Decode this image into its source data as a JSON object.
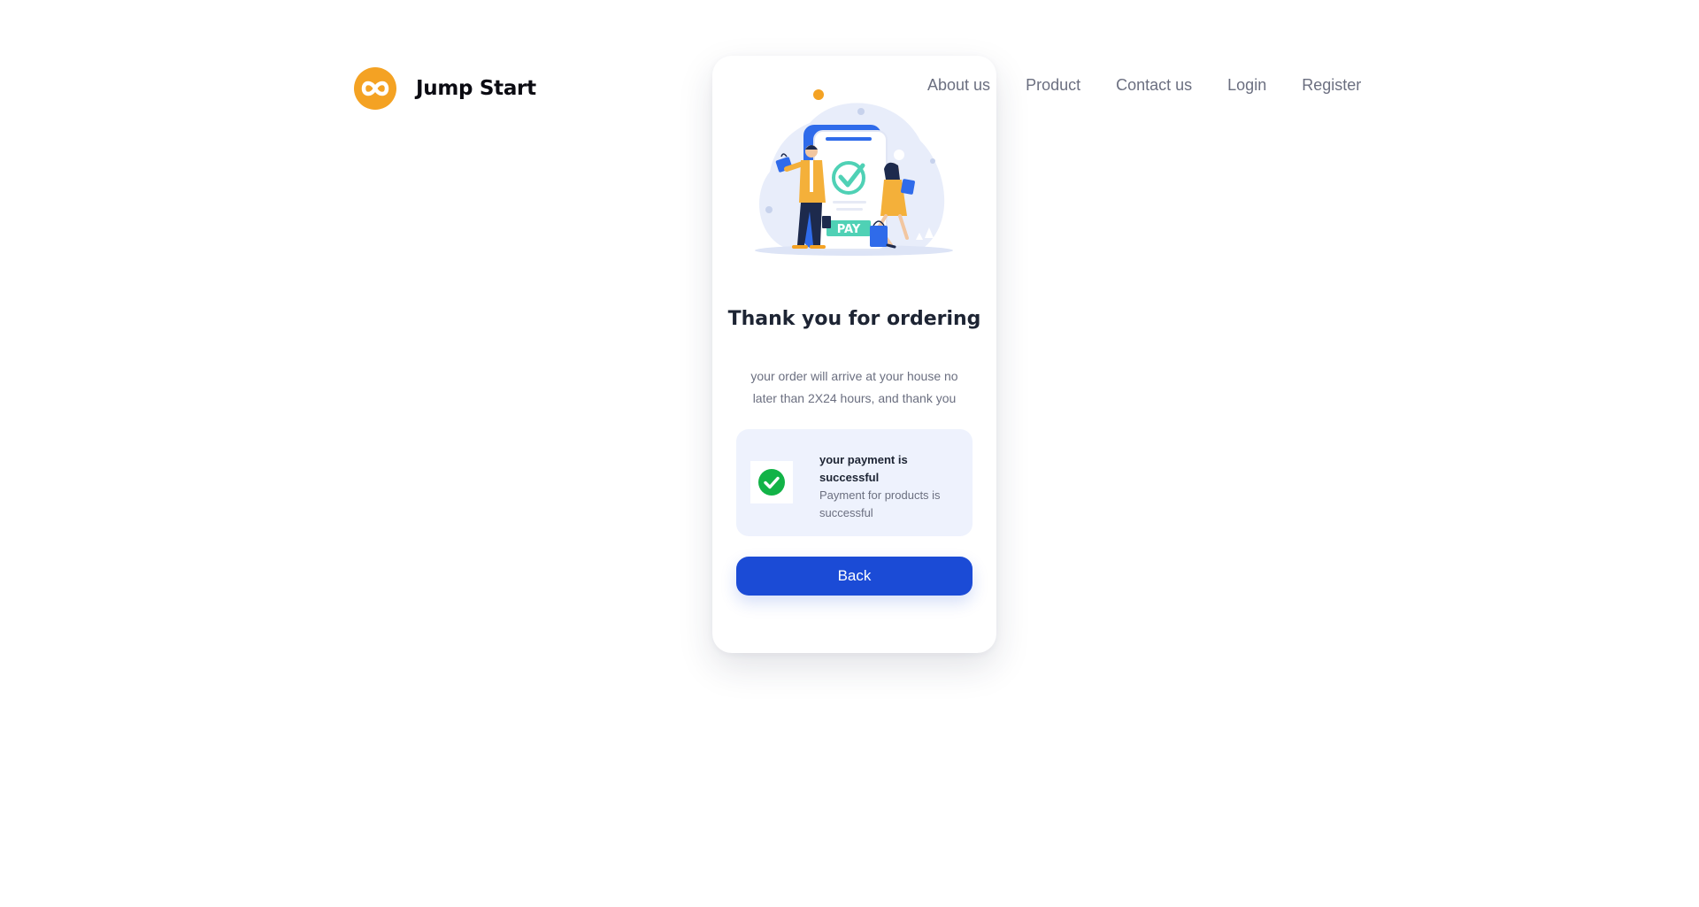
{
  "header": {
    "brand": "Jump Start",
    "nav": [
      "About us",
      "Product",
      "Contact us",
      "Login",
      "Register"
    ]
  },
  "illustration": {
    "pay_label": "PAY"
  },
  "card": {
    "title": "Thank you for ordering",
    "message": "your order will arrive at your house no later than 2X24 hours, and thank you",
    "status": {
      "title": "your payment is successful",
      "subtitle": "Payment for products is successful"
    },
    "back_label": "Back"
  },
  "colors": {
    "brand": "#F4A223",
    "primary_button": "#1B4BD6",
    "success": "#12B347",
    "status_bg": "#EEF2FD"
  }
}
